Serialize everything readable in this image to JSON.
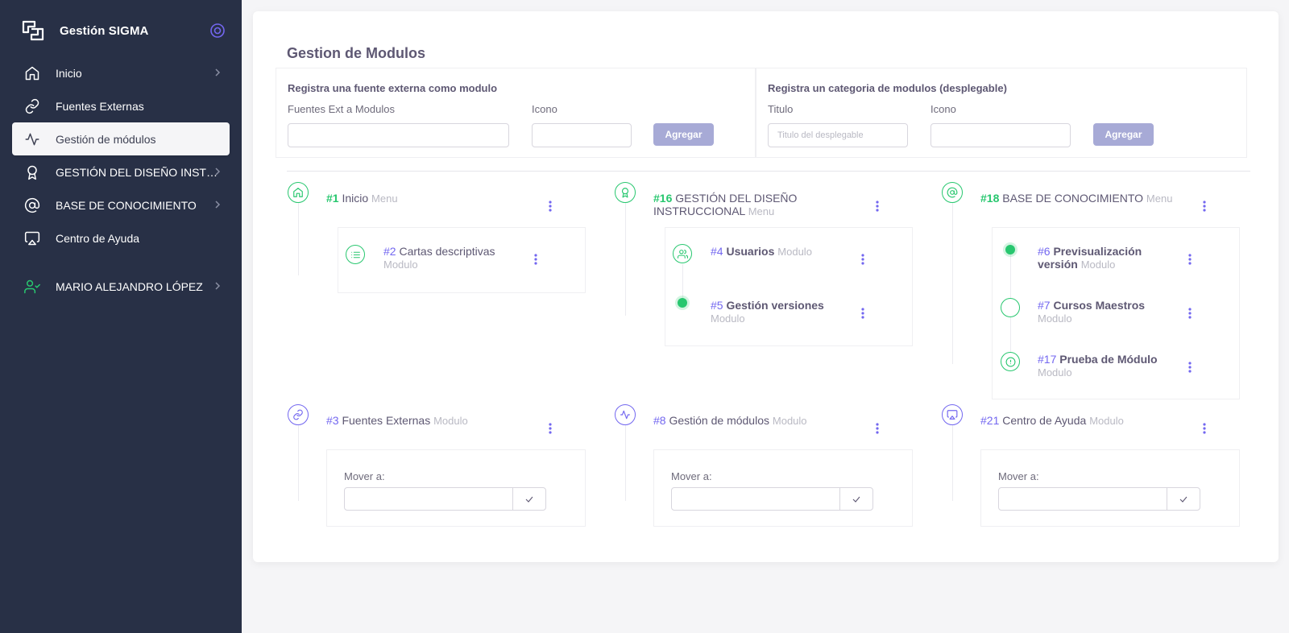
{
  "sidebar": {
    "brand": "Gestión SIGMA",
    "items": [
      {
        "label": "Inicio",
        "icon": "home-icon",
        "chevron": true
      },
      {
        "label": "Fuentes Externas",
        "icon": "link-icon",
        "chevron": false
      },
      {
        "label": "Gestión de módulos",
        "icon": "activity-icon",
        "chevron": false,
        "active": true
      },
      {
        "label": "GESTIÓN DEL DISEÑO INSTRUCCIONAL",
        "icon": "award-icon",
        "chevron": true
      },
      {
        "label": "BASE DE CONOCIMIENTO",
        "icon": "at-sign-icon",
        "chevron": true
      },
      {
        "label": "Centro de Ayuda",
        "icon": "airplay-icon",
        "chevron": false
      }
    ],
    "user": {
      "label": "MARIO ALEJANDRO LÓPEZ",
      "icon": "user-check-icon"
    }
  },
  "main": {
    "title": "Gestion de Modulos",
    "external_form": {
      "title": "Registra una fuente externa como modulo",
      "source_label": "Fuentes Ext a Modulos",
      "source_value": "",
      "icon_label": "Icono",
      "icon_value": "",
      "button": "Agregar"
    },
    "category_form": {
      "title": "Registra un categoria de modulos (desplegable)",
      "title_label": "Titulo",
      "title_placeholder": "Titulo del desplegable",
      "icon_label": "Icono",
      "icon_value": "",
      "button": "Agregar"
    },
    "modules": {
      "inicio": {
        "num": "#1",
        "name": "Inicio",
        "type": "Menu",
        "children": [
          {
            "num": "#2",
            "name": "Cartas descriptivas",
            "type": "Modulo"
          }
        ]
      },
      "diseno": {
        "num": "#16",
        "name": "GESTIÓN DEL DISEÑO INSTRUCCIONAL",
        "type": "Menu",
        "children": [
          {
            "num": "#4",
            "name": "Usuarios",
            "type": "Modulo"
          },
          {
            "num": "#5",
            "name": "Gestión versiones",
            "type": "Modulo"
          }
        ]
      },
      "base": {
        "num": "#18",
        "name": "BASE DE CONOCIMIENTO",
        "type": "Menu",
        "children": [
          {
            "num": "#6",
            "name": "Previsualización versión",
            "type": "Modulo"
          },
          {
            "num": "#7",
            "name": "Cursos Maestros",
            "type": "Modulo"
          },
          {
            "num": "#17",
            "name": "Prueba de Módulo",
            "type": "Modulo"
          }
        ]
      },
      "fuentes": {
        "num": "#3",
        "name": "Fuentes Externas",
        "type": "Modulo",
        "move_label": "Mover a:",
        "move_value": ""
      },
      "gestion": {
        "num": "#8",
        "name": "Gestión de módulos",
        "type": "Modulo",
        "move_label": "Mover a:",
        "move_value": ""
      },
      "ayuda": {
        "num": "#21",
        "name": "Centro de Ayuda",
        "type": "Modulo",
        "move_label": "Mover a:",
        "move_value": ""
      }
    }
  },
  "colors": {
    "sidebar_bg": "#283046",
    "accent_green": "#28c76f",
    "accent_purple": "#7367f0",
    "button_disabled": "#a7aad6"
  }
}
